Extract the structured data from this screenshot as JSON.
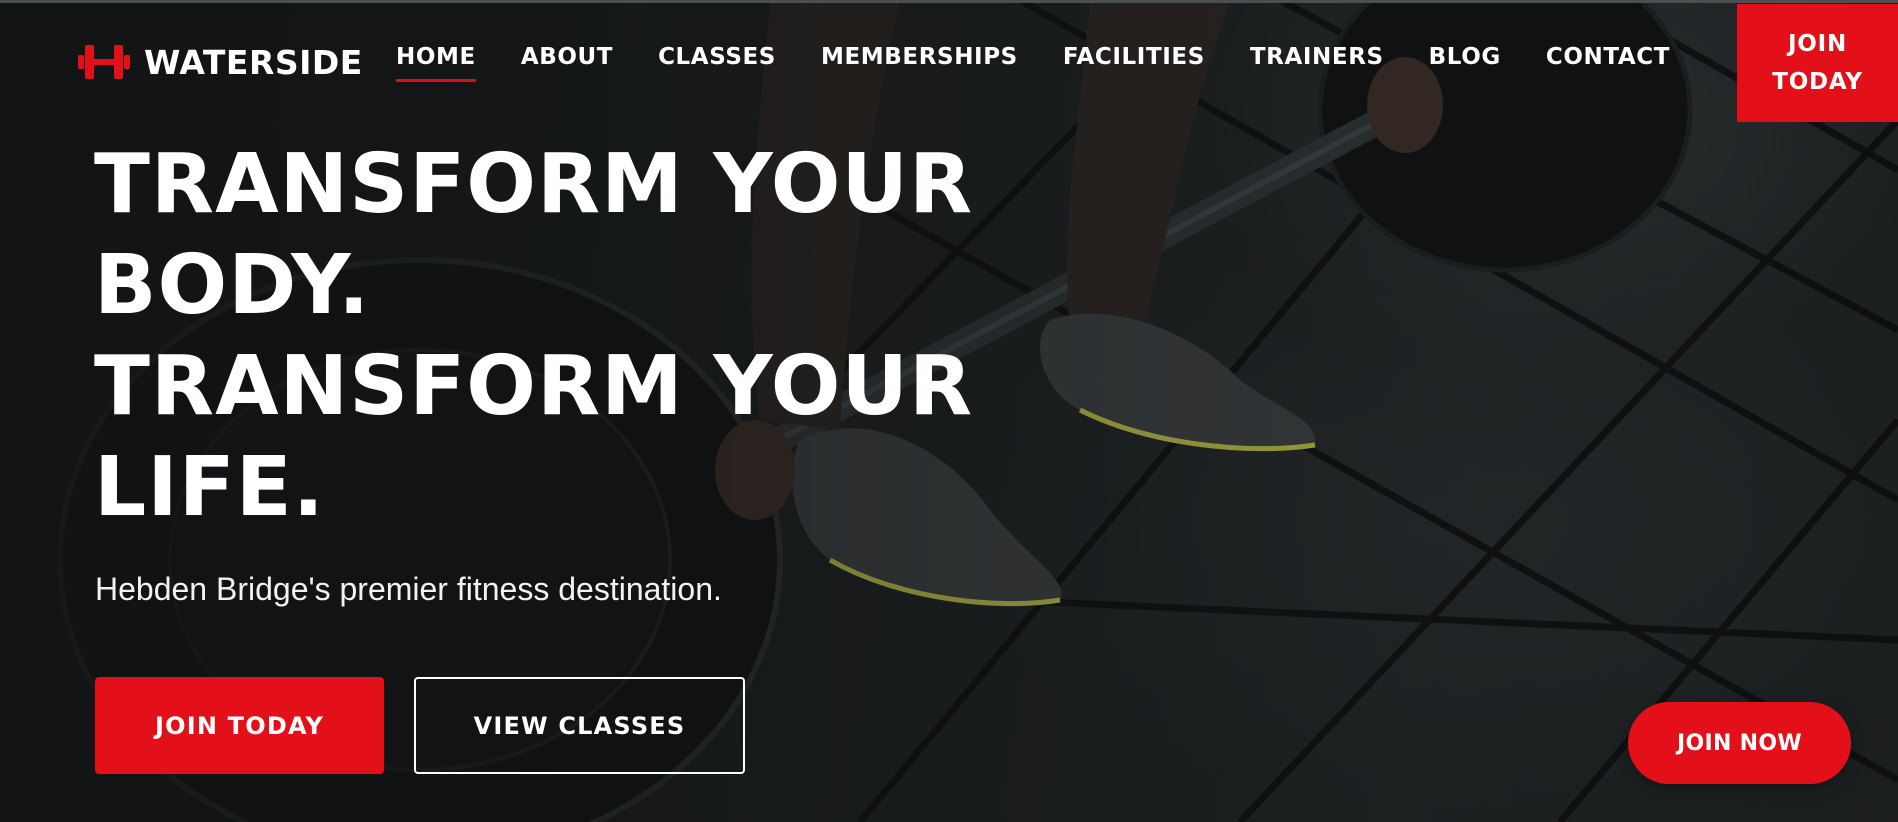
{
  "brand": {
    "name": "WATERSIDE",
    "logo_icon": "dumbbell-icon",
    "accent_color": "#e3101a"
  },
  "nav": {
    "items": [
      {
        "label": "HOME",
        "active": true
      },
      {
        "label": "ABOUT",
        "active": false
      },
      {
        "label": "CLASSES",
        "active": false
      },
      {
        "label": "MEMBERSHIPS",
        "active": false
      },
      {
        "label": "FACILITIES",
        "active": false
      },
      {
        "label": "TRAINERS",
        "active": false
      },
      {
        "label": "BLOG",
        "active": false
      },
      {
        "label": "CONTACT",
        "active": false
      }
    ],
    "cta_line1": "JOIN",
    "cta_line2": "TODAY"
  },
  "hero": {
    "headline_lines": [
      "TRANSFORM YOUR",
      "BODY.",
      "TRANSFORM YOUR",
      "LIFE."
    ],
    "subtitle": "Hebden Bridge's premier fitness destination.",
    "primary_button": "JOIN TODAY",
    "secondary_button": "VIEW CLASSES"
  },
  "floating_button": {
    "label": "JOIN NOW"
  }
}
